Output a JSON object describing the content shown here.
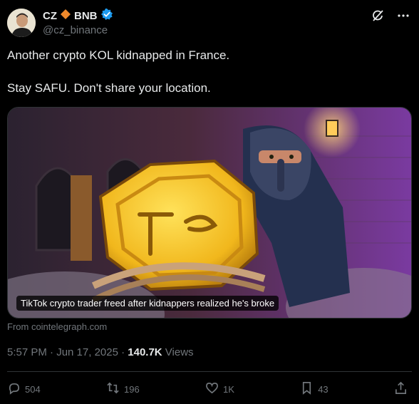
{
  "author": {
    "name": "CZ",
    "token_label": "BNB",
    "handle": "@cz_binance",
    "verified": true
  },
  "tweet": {
    "line1": "Another crypto KOL kidnapped in France.",
    "line2": "Stay SAFU. Don't share your location."
  },
  "card": {
    "caption": "TikTok crypto trader freed after kidnappers realized he's broke",
    "source": "From cointelegraph.com"
  },
  "meta": {
    "time_date": "5:57 PM · Jun 17, 2025 · ",
    "views_count": "140.7K",
    "views_label": " Views"
  },
  "actions": {
    "replies": "504",
    "reposts": "196",
    "likes": "1K",
    "bookmarks": "43"
  },
  "icons": [
    "grok-icon",
    "more-icon",
    "verified-badge-icon",
    "diamond-icon",
    "reply-icon",
    "repost-icon",
    "like-icon",
    "bookmark-icon",
    "share-icon"
  ],
  "colors": {
    "verified": "#1d9bf0",
    "diamond": "#f0b90b",
    "muted": "#71767b"
  }
}
